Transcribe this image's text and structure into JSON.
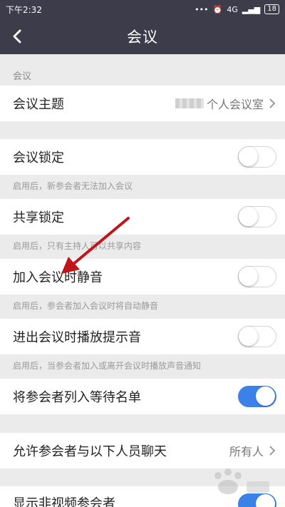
{
  "status": {
    "time": "下午2:32",
    "signal": "4G",
    "battery": "18"
  },
  "nav": {
    "title": "会议"
  },
  "section_header": "会议",
  "topic": {
    "label": "会议主题",
    "value": "个人会议室"
  },
  "lock": {
    "label": "会议锁定",
    "desc": "启用后，新参会者无法加入会议",
    "on": false
  },
  "share": {
    "label": "共享锁定",
    "desc": "启用后，只有主持人可以共享内容",
    "on": false
  },
  "mute": {
    "label": "加入会议时静音",
    "desc": "启用后，参会者加入会议时将自动静音",
    "on": false
  },
  "chime": {
    "label": "进出会议时播放提示音",
    "desc": "启用后，当参会者加入或离开会议时播放声音通知",
    "on": false
  },
  "waiting": {
    "label": "将参会者列入等待名单",
    "on": true
  },
  "chat": {
    "label": "允许参会者与以下人员聊天",
    "value": "所有人"
  },
  "nonvideo": {
    "label": "显示非视频参会者",
    "on": true
  },
  "colors": {
    "bar": "#3c3c4a",
    "accent": "#3b82e8",
    "arrow": "#c0151a"
  }
}
